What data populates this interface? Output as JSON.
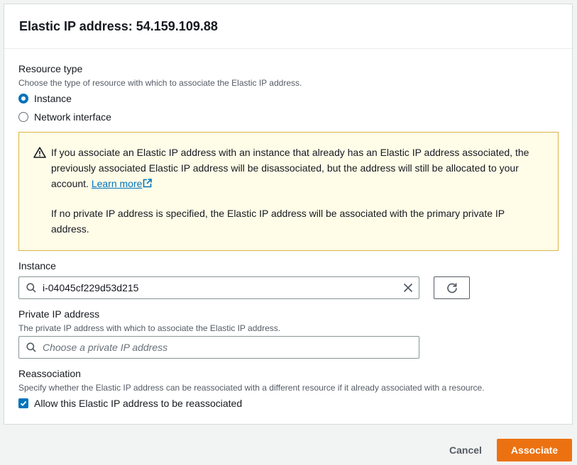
{
  "dialog": {
    "title": "Elastic IP address: 54.159.109.88"
  },
  "resource_type": {
    "label": "Resource type",
    "description": "Choose the type of resource with which to associate the Elastic IP address.",
    "options": [
      {
        "label": "Instance",
        "selected": true
      },
      {
        "label": "Network interface",
        "selected": false
      }
    ]
  },
  "alert": {
    "icon": "warning-icon",
    "text_before_link": "If you associate an Elastic IP address with an instance that already has an Elastic IP address associated, the previously associated Elastic IP address will be disassociated, but the address will still be allocated to your account. ",
    "link_label": "Learn more",
    "paragraph2": "If no private IP address is specified, the Elastic IP address will be associated with the primary private IP address."
  },
  "instance": {
    "label": "Instance",
    "value": "i-04045cf229d53d215"
  },
  "private_ip": {
    "label": "Private IP address",
    "description": "The private IP address with which to associate the Elastic IP address.",
    "placeholder": "Choose a private IP address"
  },
  "reassociation": {
    "label": "Reassociation",
    "description": "Specify whether the Elastic IP address can be reassociated with a different resource if it already associated with a resource.",
    "checkbox_label": "Allow this Elastic IP address to be reassociated",
    "checked": true
  },
  "footer": {
    "cancel_label": "Cancel",
    "associate_label": "Associate"
  },
  "colors": {
    "primary": "#ec7211",
    "accent": "#0073bb",
    "warning_bg": "#fffce8",
    "warning_border": "#d9b43e"
  }
}
